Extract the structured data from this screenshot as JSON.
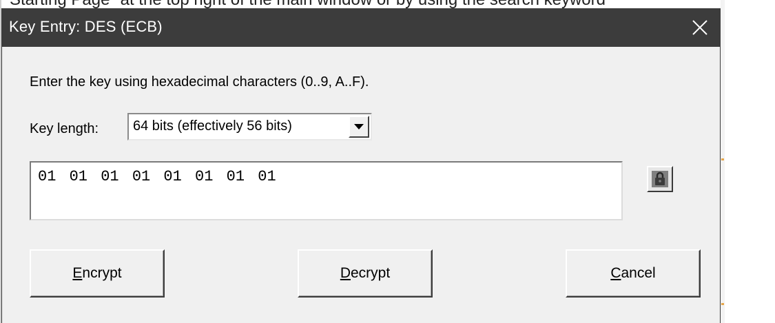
{
  "background": {
    "window_text": "Starting Page\" at the top right of the main window or by using the search keyword"
  },
  "dialog": {
    "title": "Key Entry: DES (ECB)",
    "close_glyph": "✕",
    "instruction": "Enter the key using hexadecimal characters (0..9, A..F).",
    "key_length_label": "Key length:",
    "key_length_selected": "64 bits (effectively 56 bits)",
    "key_value": "01 01 01 01 01 01 01 01",
    "lock_icon": "lock-icon",
    "buttons": {
      "encrypt_mnemonic": "E",
      "encrypt_rest": "ncrypt",
      "decrypt_mnemonic": "D",
      "decrypt_rest": "ecrypt",
      "cancel_mnemonic": "C",
      "cancel_rest": "ancel"
    }
  },
  "colors": {
    "titlebar_bg": "#3c3c3c",
    "titlebar_text": "#ffffff",
    "dialog_bg": "#f0f0f0"
  }
}
